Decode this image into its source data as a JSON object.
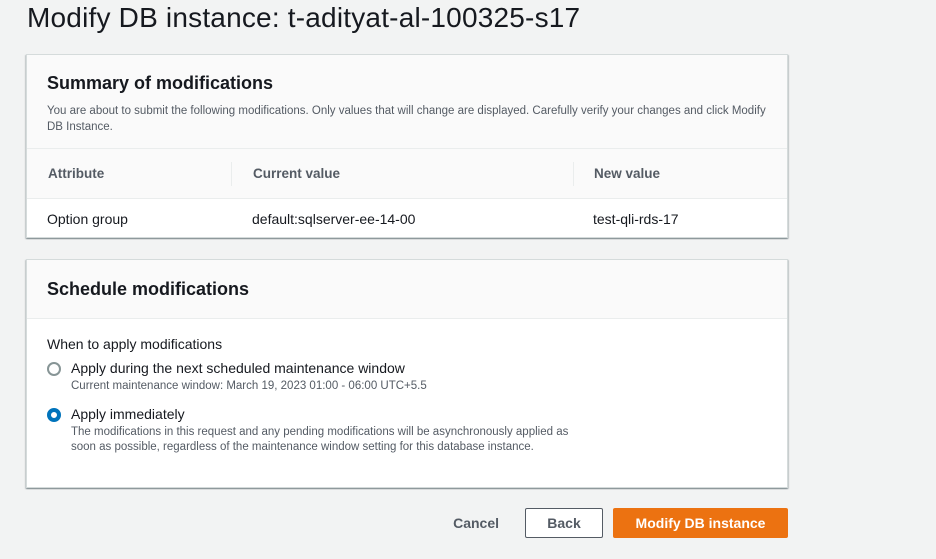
{
  "page": {
    "title": "Modify DB instance: t-adityat-al-100325-s17"
  },
  "summary": {
    "heading": "Summary of modifications",
    "description": "You are about to submit the following modifications. Only values that will change are displayed. Carefully verify your changes and click Modify DB Instance.",
    "columns": [
      "Attribute",
      "Current value",
      "New value"
    ],
    "rows": [
      {
        "attribute": "Option group",
        "current": "default:sqlserver-ee-14-00",
        "new": "test-qli-rds-17"
      }
    ]
  },
  "schedule": {
    "heading": "Schedule modifications",
    "field_label": "When to apply modifications",
    "options": [
      {
        "label": "Apply during the next scheduled maintenance window",
        "description": "Current maintenance window: March 19, 2023 01:00 - 06:00 UTC+5.5",
        "selected": false
      },
      {
        "label": "Apply immediately",
        "description": "The modifications in this request and any pending modifications will be asynchronously applied as soon as possible, regardless of the maintenance window setting for this database instance.",
        "selected": true
      }
    ]
  },
  "actions": {
    "cancel_label": "Cancel",
    "back_label": "Back",
    "submit_label": "Modify DB instance"
  },
  "colors": {
    "primary": "#ec7211",
    "selected_radio": "#0073bb",
    "background": "#f2f3f3"
  }
}
